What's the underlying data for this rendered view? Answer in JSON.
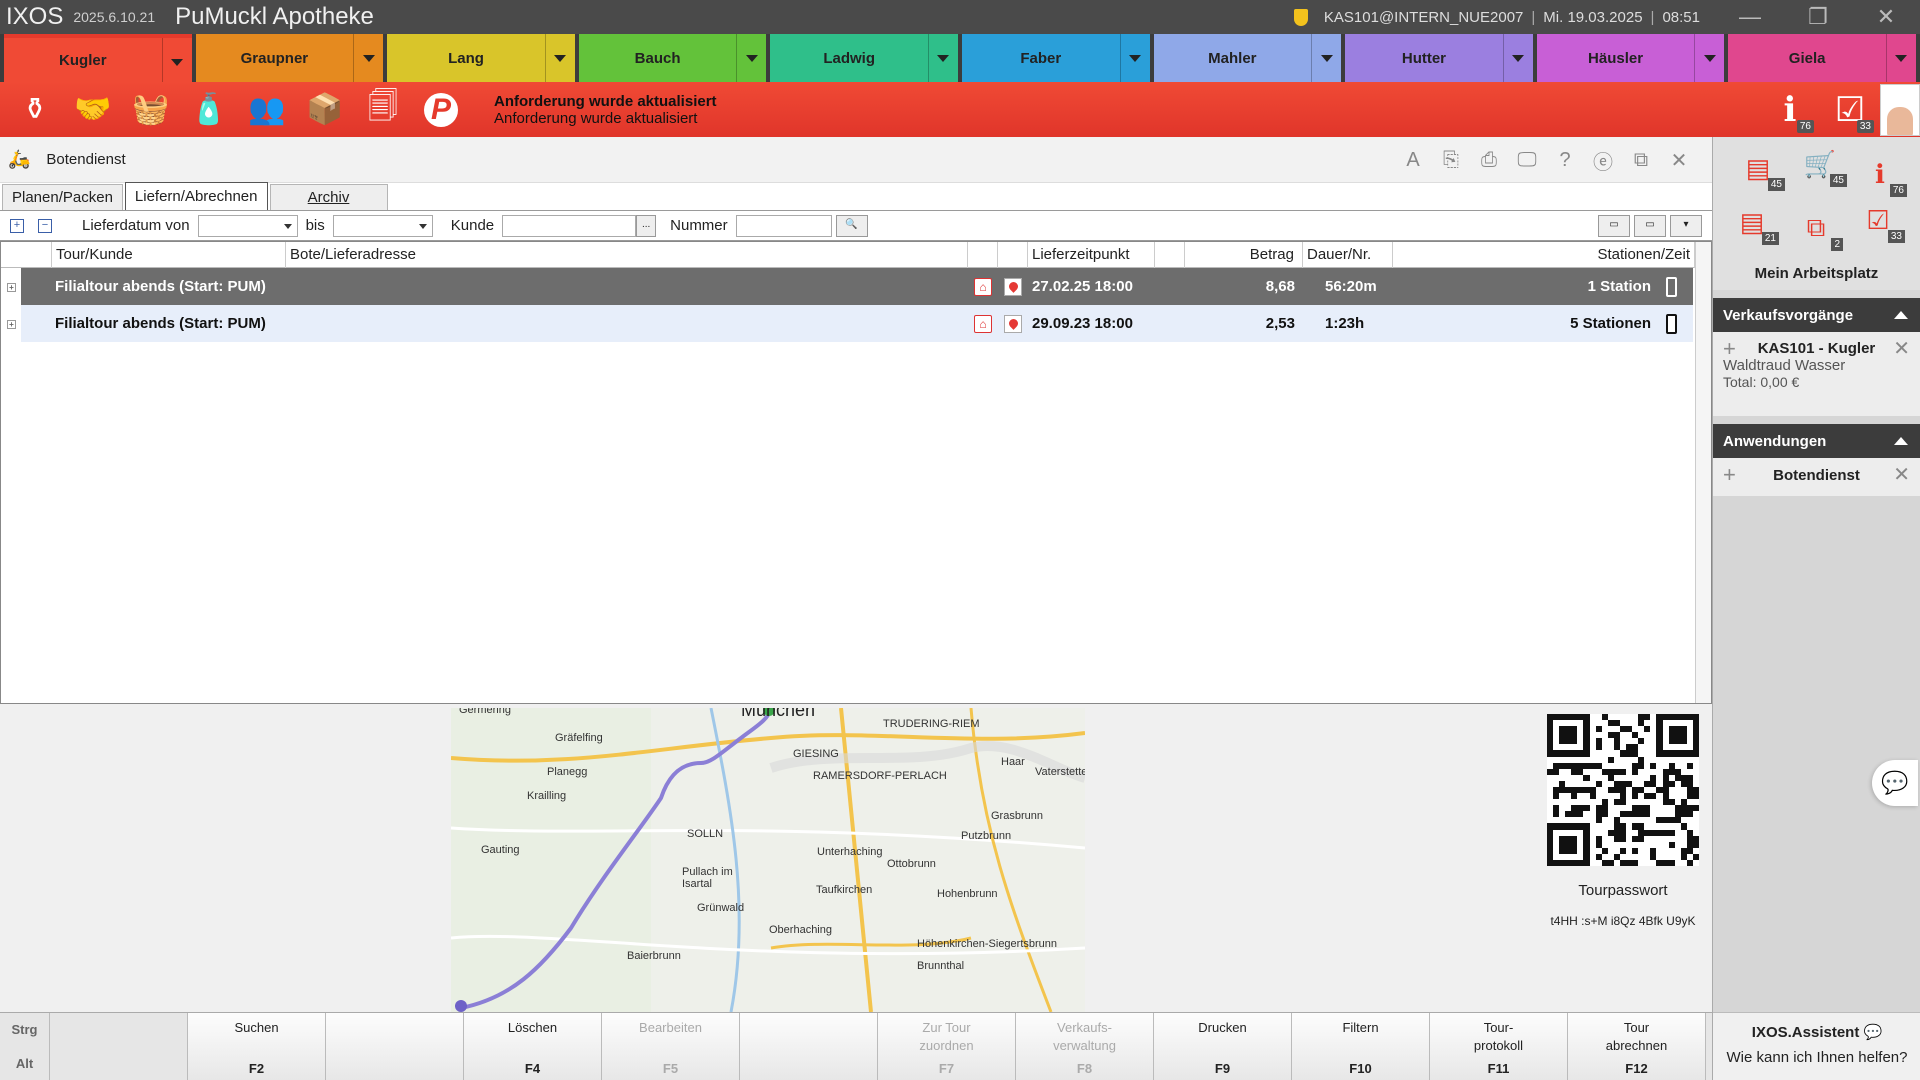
{
  "titlebar": {
    "app": "IXOS",
    "version": "2025.6.10.21",
    "pharmacy": "PuMuckl Apotheke",
    "user": "KAS101@INTERN_NUE2007",
    "date": "Mi. 19.03.2025",
    "time": "08:51"
  },
  "user_tabs": [
    {
      "label": "Kugler",
      "color": "#f04a35"
    },
    {
      "label": "Graupner",
      "color": "#e58a1f"
    },
    {
      "label": "Lang",
      "color": "#d9c52a"
    },
    {
      "label": "Bauch",
      "color": "#63c23a"
    },
    {
      "label": "Ladwig",
      "color": "#2fbf8a"
    },
    {
      "label": "Faber",
      "color": "#2a9fd9"
    },
    {
      "label": "Mahler",
      "color": "#8fa8e8"
    },
    {
      "label": "Hutter",
      "color": "#9b7fe0"
    },
    {
      "label": "Häusler",
      "color": "#c85fd6"
    },
    {
      "label": "Giela",
      "color": "#e0478e"
    }
  ],
  "notification": {
    "title": "Anforderung wurde aktualisiert",
    "text": "Anforderung wurde aktualisiert"
  },
  "red_badges": {
    "info": "76",
    "tasks": "33"
  },
  "module": {
    "title": "Botendienst"
  },
  "tabs": [
    "Planen/Packen",
    "Liefern/Abrechnen",
    "Archiv"
  ],
  "filter": {
    "date_from_label": "Lieferdatum von",
    "date_to_label": "bis",
    "customer_label": "Kunde",
    "number_label": "Nummer",
    "ellipsis": "..."
  },
  "grid": {
    "headers": [
      "Tour/Kunde",
      "Bote/Lieferadresse",
      "Lieferzeitpunkt",
      "Betrag",
      "Dauer/Nr.",
      "Stationen/Zeit"
    ],
    "rows": [
      {
        "tour": "Filialtour abends (Start: PUM)",
        "time": "27.02.25 18:00",
        "amount": "8,68",
        "duration": "56:20m",
        "stations": "1 Station"
      },
      {
        "tour": "Filialtour abends (Start: PUM)",
        "time": "29.09.23 18:00",
        "amount": "2,53",
        "duration": "1:23h",
        "stations": "5 Stationen"
      }
    ]
  },
  "map": {
    "labels": [
      "München",
      "Gräfelfing",
      "Planegg",
      "Krailling",
      "Gauting",
      "SOLLN",
      "Pullach im Isartal",
      "Grünwald",
      "Baierbrunn",
      "TRUDERING-RIEM",
      "Haar",
      "GIESING",
      "RAMERSDORF-PERLACH",
      "Vaterstetten",
      "Unterhaching",
      "Ottobrunn",
      "Taufkirchen",
      "Putzbrunn",
      "Grasbrunn",
      "Hohenbrunn",
      "Oberhaching",
      "Höhenkirchen-Siegertsbrunn",
      "Brunnthal",
      "Germering"
    ]
  },
  "qr": {
    "label": "Tourpasswort",
    "password": "t4HH :s+M i8Qz 4Bfk U9yK"
  },
  "fkeys": [
    {
      "label": "Suchen",
      "key": "F2",
      "disabled": false
    },
    {
      "label": "",
      "key": "",
      "disabled": false
    },
    {
      "label": "Löschen",
      "key": "F4",
      "disabled": false
    },
    {
      "label": "Bearbeiten",
      "key": "F5",
      "disabled": true
    },
    {
      "label": "",
      "key": "",
      "disabled": false
    },
    {
      "label": "Zur Tour zuordnen",
      "key": "F7",
      "disabled": true
    },
    {
      "label": "Verkaufs- verwaltung",
      "key": "F8",
      "disabled": true
    },
    {
      "label": "Drucken",
      "key": "F9",
      "disabled": false
    },
    {
      "label": "Filtern",
      "key": "F10",
      "disabled": false
    },
    {
      "label": "Tour- protokoll",
      "key": "F11",
      "disabled": false
    },
    {
      "label": "Tour abrechnen",
      "key": "F12",
      "disabled": false
    }
  ],
  "modkeys": [
    "Strg",
    "Alt"
  ],
  "sidebar": {
    "workspace_title": "Mein Arbeitsplatz",
    "workspace_badges": [
      "45",
      "45",
      "76",
      "21",
      "2",
      "33"
    ],
    "sales_title": "Verkaufsvorgänge",
    "sale": {
      "name": "KAS101 - Kugler",
      "customer": "Waldtraud Wasser",
      "total": "Total: 0,00 €"
    },
    "apps_title": "Anwendungen",
    "app": "Botendienst",
    "assistant_title": "IXOS.Assistent",
    "assistant_text": "Wie kann ich Ihnen helfen?"
  }
}
